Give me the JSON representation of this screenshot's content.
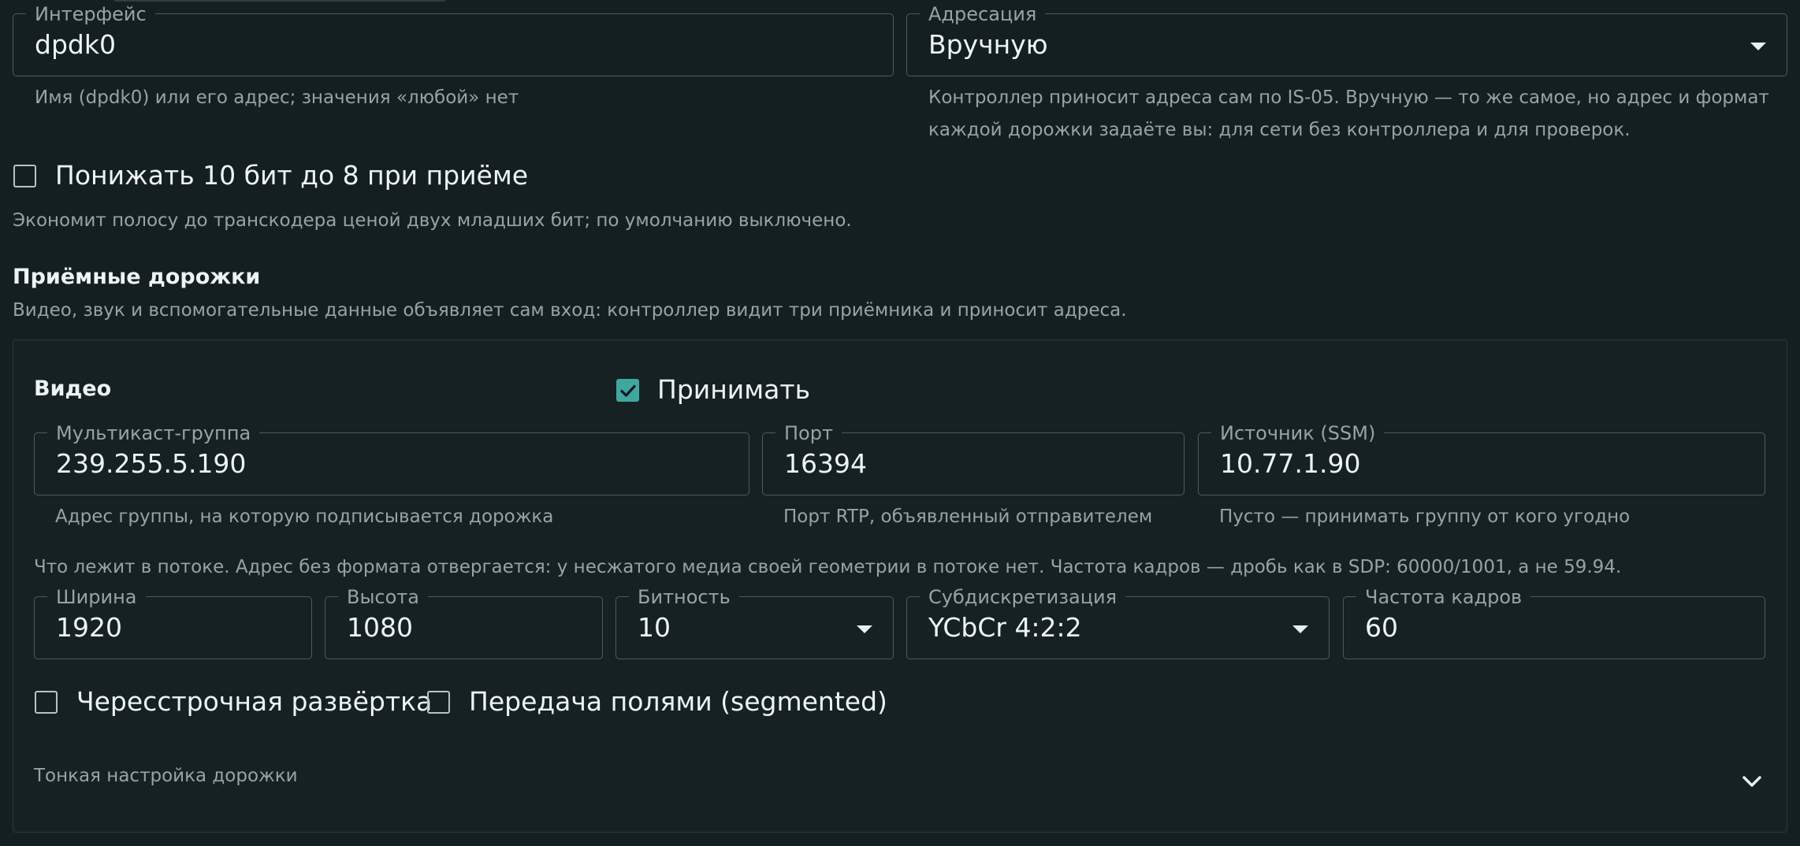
{
  "interface": {
    "legend": "Интерфейс",
    "value": "dpdk0",
    "helper": "Имя (dpdk0) или его адрес; значения «любой» нет"
  },
  "addressing": {
    "legend": "Адресация",
    "value": "Вручную",
    "helper_line1": "Контроллер приносит адреса сам по IS-05. Вручную — то же самое, но адрес и формат",
    "helper_line2": "каждой дорожки задаёте вы: для сети без контроллера и для проверок."
  },
  "downconvert": {
    "label": "Понижать 10 бит до 8 при приёме",
    "checked": false,
    "helper": "Экономит полосу до транскодера ценой двух младших бит; по умолчанию выключено."
  },
  "tracks": {
    "title": "Приёмные дорожки",
    "subtitle": "Видео, звук и вспомогательные данные объявляет сам вход: контроллер видит три приёмника и приносит адреса."
  },
  "video": {
    "title": "Видео",
    "receive": {
      "label": "Принимать",
      "checked": true
    },
    "multicast": {
      "legend": "Мультикаст-группа",
      "value": "239.255.5.190",
      "helper": "Адрес группы, на которую подписывается дорожка"
    },
    "port": {
      "legend": "Порт",
      "value": "16394",
      "helper": "Порт RTP, объявленный отправителем"
    },
    "source": {
      "legend": "Источник (SSM)",
      "value": "10.77.1.90",
      "helper": "Пусто — принимать группу от кого угодно"
    },
    "format_note": "Что лежит в потоке. Адрес без формата отвергается: у несжатого медиа своей геометрии в потоке нет. Частота кадров — дробь как в SDP: 60000/1001, а не 59.94.",
    "width": {
      "legend": "Ширина",
      "value": "1920"
    },
    "height": {
      "legend": "Высота",
      "value": "1080"
    },
    "bitdepth": {
      "legend": "Битность",
      "value": "10"
    },
    "sampling": {
      "legend": "Субдискретизация",
      "value": "YCbCr 4:2:2"
    },
    "framerate": {
      "legend": "Частота кадров",
      "value": "60"
    },
    "interlaced": {
      "label": "Чересстрочная развёртка",
      "checked": false
    },
    "segmented": {
      "label": "Передача полями (segmented)",
      "checked": false
    },
    "fine_tune": {
      "label": "Тонкая настройка дорожки"
    }
  },
  "colors": {
    "background": "#141f21",
    "accent": "#3fa7a0",
    "border": "#4e5b5d"
  }
}
